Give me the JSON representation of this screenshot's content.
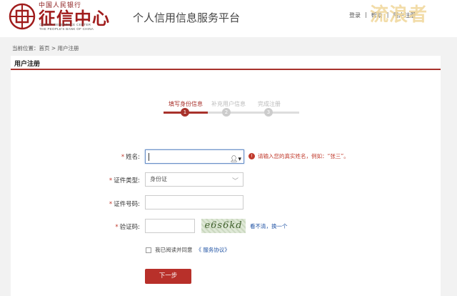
{
  "header": {
    "logo_top_text": "中国人民银行",
    "logo_main_text": "征信中心",
    "logo_en_line1": "CREDIT REFERENCE CENTER",
    "logo_en_line2": "THE PEOPLE'S BANK OF CHINA",
    "platform_title": "个人信用信息服务平台",
    "links": [
      "登录",
      "|",
      "帮助",
      "|",
      "用户注册"
    ],
    "watermark": "流浪者"
  },
  "breadcrumb": "当前位置：首页 > 用户注册",
  "section_title": "用户注册",
  "steps": [
    {
      "label": "填写身份信息",
      "number": "1",
      "active": true
    },
    {
      "label": "补充用户信息",
      "number": "2",
      "active": false
    },
    {
      "label": "完成注册",
      "number": "3",
      "active": false
    }
  ],
  "form": {
    "required_mark": "*",
    "name_label": "姓名:",
    "name_value": "",
    "name_hint": "请输入您的真实姓名，例如：“张三”。",
    "hint_icon": "!",
    "user_icon": "person-icon",
    "id_type_label": "证件类型:",
    "id_type_value": "身份证",
    "select_arrow": "﹀",
    "id_number_label": "证件号码:",
    "id_number_value": "",
    "captcha_label": "验证码:",
    "captcha_value": "",
    "captcha_text": "e6s6kd",
    "refresh_text": "看不清，换一个",
    "agree_prefix": "我已阅读并同意",
    "agree_link": "《 服务协议》",
    "next_button": "下一步"
  },
  "colors": {
    "brand_red": "#a8322c",
    "link_blue": "#2456a6"
  }
}
